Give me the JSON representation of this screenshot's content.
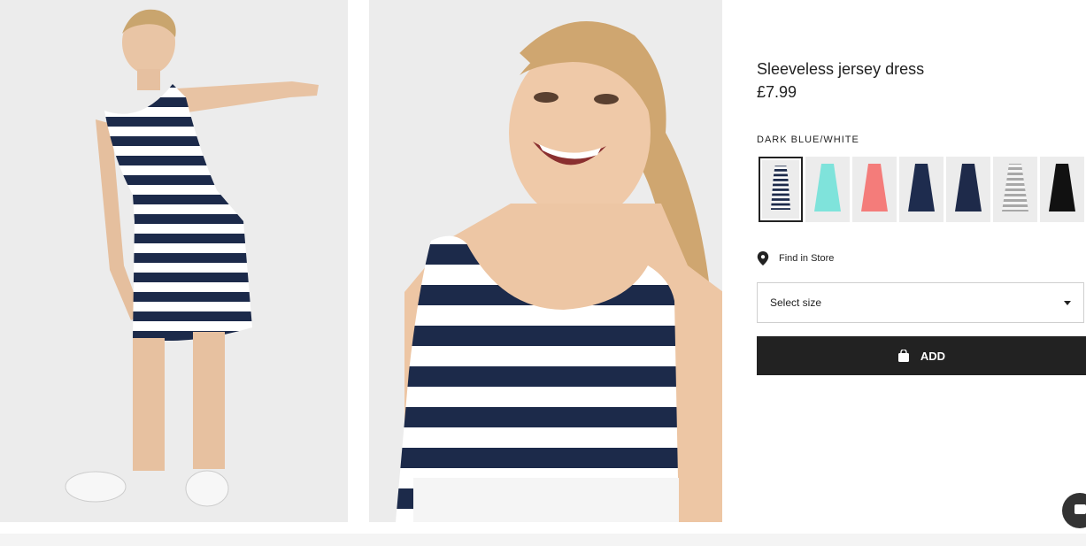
{
  "product": {
    "title": "Sleeveless jersey dress",
    "price": "£7.99",
    "color_label": "DARK BLUE/WHITE"
  },
  "swatches": [
    {
      "name": "dark-blue-white-stripe",
      "color": "#1c2a4a",
      "stripe": "#ffffff",
      "selected": true
    },
    {
      "name": "turquoise",
      "color": "#7fe3db"
    },
    {
      "name": "coral",
      "color": "#f47c7a"
    },
    {
      "name": "dark-blue-dotted",
      "color": "#1e2c4e"
    },
    {
      "name": "dark-blue-print",
      "color": "#1e2a4a"
    },
    {
      "name": "white-grey-stripe",
      "color": "#dcdcdc",
      "stripe": "#a8a8a8"
    },
    {
      "name": "black",
      "color": "#111111"
    }
  ],
  "find_in_store": {
    "label": "Find in Store",
    "icon": "map-pin-icon"
  },
  "size_select": {
    "placeholder": "Select size",
    "icon": "chevron-down-icon"
  },
  "add_button": {
    "label": "ADD",
    "icon": "shopping-bag-icon"
  },
  "chat": {
    "icon": "chat-icon"
  },
  "colors": {
    "dress_navy": "#1c2a4a",
    "button_bg": "#222222",
    "photo_bg": "#ececec"
  }
}
